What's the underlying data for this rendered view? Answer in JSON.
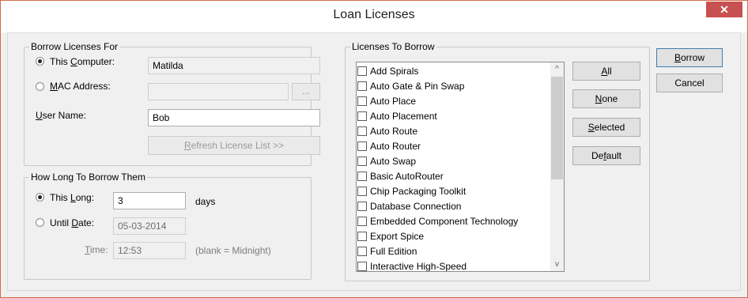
{
  "window": {
    "title": "Loan Licenses",
    "close_glyph": "✕"
  },
  "borrow_for": {
    "legend": "Borrow Licenses For",
    "this_computer": {
      "label_pre": "This ",
      "label_key": "C",
      "label_post": "omputer:",
      "value": "Matilda"
    },
    "mac_address": {
      "label_key": "M",
      "label_post": "AC Address:",
      "value": "",
      "browse": "..."
    },
    "user_name": {
      "label_key": "U",
      "label_post": "ser Name:",
      "value": "Bob"
    },
    "refresh": {
      "key": "R",
      "post": "efresh License List >>"
    }
  },
  "how_long": {
    "legend": "How Long To Borrow Them",
    "this_long": {
      "label_pre": "This ",
      "label_key": "L",
      "label_post": "ong:",
      "value": "3",
      "unit": "days"
    },
    "until_date": {
      "label_pre": "Until ",
      "label_key": "D",
      "label_post": "ate:",
      "value": "05-03-2014"
    },
    "time": {
      "label_key": "T",
      "label_post": "ime:",
      "value": "12:53",
      "hint": "(blank = Midnight)"
    }
  },
  "licenses": {
    "legend": "Licenses To Borrow",
    "items": [
      "Add Spirals",
      "Auto Gate & Pin Swap",
      "Auto Place",
      "Auto Placement",
      "Auto Route",
      "Auto Router",
      "Auto Swap",
      "Basic AutoRouter",
      "Chip Packaging Toolkit",
      "Database Connection",
      "Embedded Component Technology",
      "Export Spice",
      "Full Edition",
      "Interactive High-Speed"
    ],
    "scroll_up": "^",
    "scroll_down": "v"
  },
  "selection_buttons": {
    "all": {
      "key": "A",
      "post": "ll"
    },
    "none": {
      "key": "N",
      "post": "one"
    },
    "selected": {
      "key": "S",
      "post": "elected"
    },
    "default": {
      "pre": "De",
      "key": "f",
      "post": "ault"
    }
  },
  "actions": {
    "borrow": {
      "key": "B",
      "post": "orrow"
    },
    "cancel": "Cancel"
  }
}
